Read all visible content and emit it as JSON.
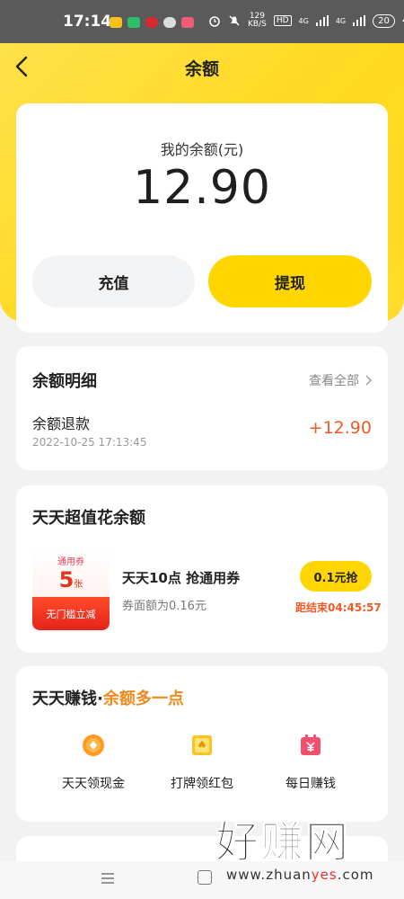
{
  "status_bar": {
    "time": "17:14",
    "speed_value": "129",
    "speed_unit": "KB/S",
    "hd_label": "HD",
    "net_label_1": "4G",
    "net_label_2": "4G",
    "battery": "20"
  },
  "header": {
    "title": "余额"
  },
  "balance": {
    "label": "我的余额(元)",
    "amount": "12.90",
    "recharge_label": "充值",
    "withdraw_label": "提现"
  },
  "details": {
    "title": "余额明细",
    "view_all": "查看全部",
    "record": {
      "title": "余额退款",
      "time": "2022-10-25 17:13:45",
      "amount": "+12.90"
    }
  },
  "coupon": {
    "section_title": "天天超值花余额",
    "type": "通用券",
    "count": "5",
    "unit": "张",
    "badge": "无门槛立减",
    "title": "天天10点 抢通用券",
    "subtitle": "券面额为0.16元",
    "grab_label": "0.1元抢",
    "countdown": "距结束04:45:57"
  },
  "earn": {
    "title_main": "天天赚钱·",
    "title_highlight": "余额多一点",
    "items": [
      {
        "label": "天天领现金",
        "icon": "coin-icon"
      },
      {
        "label": "打牌领红包",
        "icon": "card-icon"
      },
      {
        "label": "每日赚钱",
        "icon": "calendar-money-icon"
      }
    ]
  },
  "watermark": {
    "big": "好赚网",
    "domain_prefix": "www.zhuan",
    "domain_highlight": "yes",
    "domain_suffix": ".com"
  },
  "colors": {
    "brand_yellow": "#ffd600",
    "accent_orange": "#f15a24",
    "highlight_orange": "#f08a1c"
  }
}
